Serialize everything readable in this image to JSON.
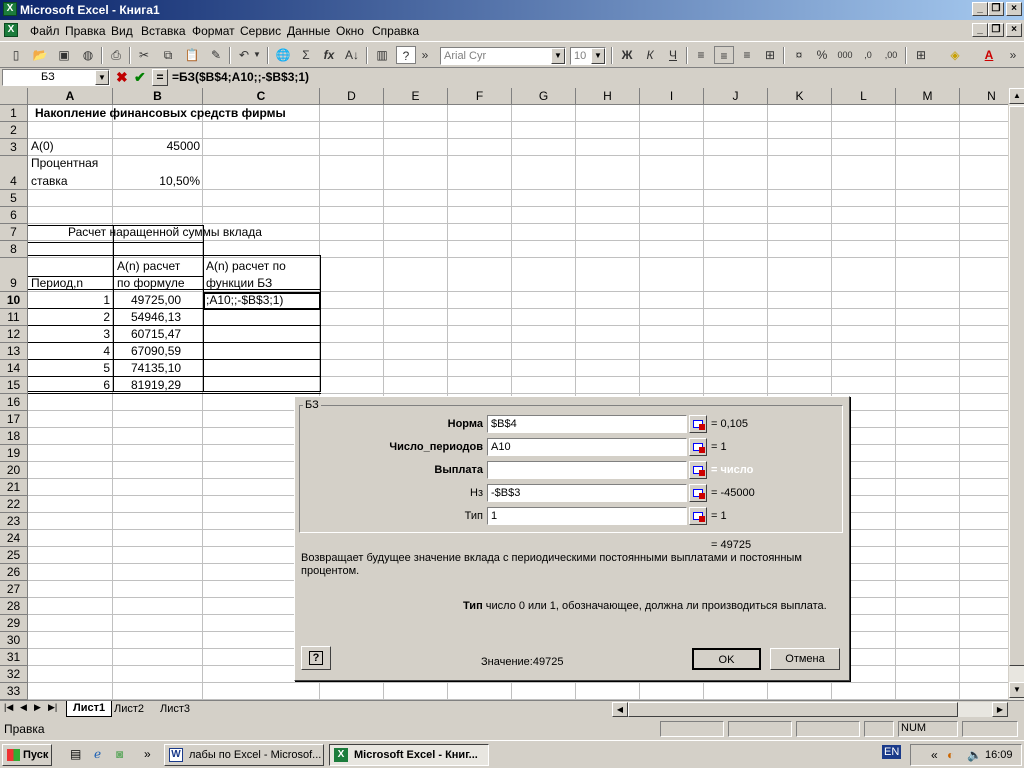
{
  "window": {
    "title": "Microsoft Excel - Книга1"
  },
  "menu": [
    "Файл",
    "Правка",
    "Вид",
    "Вставка",
    "Формат",
    "Сервис",
    "Данные",
    "Окно",
    "Справка"
  ],
  "toolbar": {
    "font": "Arial Cyr",
    "size": "10"
  },
  "formula_bar": {
    "name_box": "БЗ",
    "equals": "=",
    "formula": "=БЗ($B$4;A10;;-$B$3;1)"
  },
  "columns": [
    "A",
    "B",
    "C",
    "D",
    "E",
    "F",
    "G",
    "H",
    "I",
    "J",
    "K",
    "L",
    "M",
    "N"
  ],
  "rows": [
    "1",
    "2",
    "3",
    "4",
    "5",
    "6",
    "7",
    "8",
    "9",
    "10",
    "11",
    "12",
    "13",
    "14",
    "15",
    "16",
    "17",
    "18",
    "19",
    "20",
    "21",
    "22",
    "23",
    "24",
    "25",
    "26",
    "27",
    "28",
    "29",
    "30",
    "31",
    "32",
    "33"
  ],
  "cells": {
    "title": "Накопление финансовых средств фирмы",
    "a3": "A(0)",
    "b3": "45000",
    "a4_1": "Процентная",
    "a4_2": "ставка",
    "b4": "10,50%",
    "a7": "Расчет наращенной суммы вклада",
    "a9": "Период,n",
    "b9_1": "A(n) расчет",
    "b9_2": "по формуле",
    "c9_1": "A(n) расчет по",
    "c9_2": "функции БЗ",
    "c10": ";A10;;-$B$3;1)",
    "periods": [
      "1",
      "2",
      "3",
      "4",
      "5",
      "6"
    ],
    "amounts": [
      "49725,00",
      "54946,13",
      "60715,47",
      "67090,59",
      "74135,10",
      "81919,29"
    ]
  },
  "dialog": {
    "group": "БЗ",
    "args": [
      {
        "label": "Норма",
        "value": "$B$4",
        "result": "= 0,105",
        "bold": true
      },
      {
        "label": "Число_периодов",
        "value": "A10",
        "result": "= 1",
        "bold": true
      },
      {
        "label": "Выплата",
        "value": "",
        "result": "= число",
        "bold": true
      },
      {
        "label": "Нз",
        "value": "-$B$3",
        "result": "= -45000",
        "bold": false
      },
      {
        "label": "Тип",
        "value": "1",
        "result": "= 1",
        "bold": false
      }
    ],
    "total": "= 49725",
    "description": "Возвращает будущее значение вклада  с периодическими постоянными выплатами и постоянным процентом.",
    "arg_help_name": "Тип",
    "arg_help_text": " число 0 или 1, обозначающее, должна ли производиться выплата.",
    "value_label": "Значение:",
    "value": "49725",
    "ok": "OK",
    "cancel": "Отмена",
    "help": "?"
  },
  "sheets": [
    "Лист1",
    "Лист2",
    "Лист3"
  ],
  "status": {
    "mode": "Правка",
    "num": "NUM"
  },
  "taskbar": {
    "start": "Пуск",
    "tasks": [
      "лабы по Excel - Microsof...",
      "Microsoft Excel - Книг..."
    ],
    "lang": "EN",
    "clock": "16:09"
  }
}
